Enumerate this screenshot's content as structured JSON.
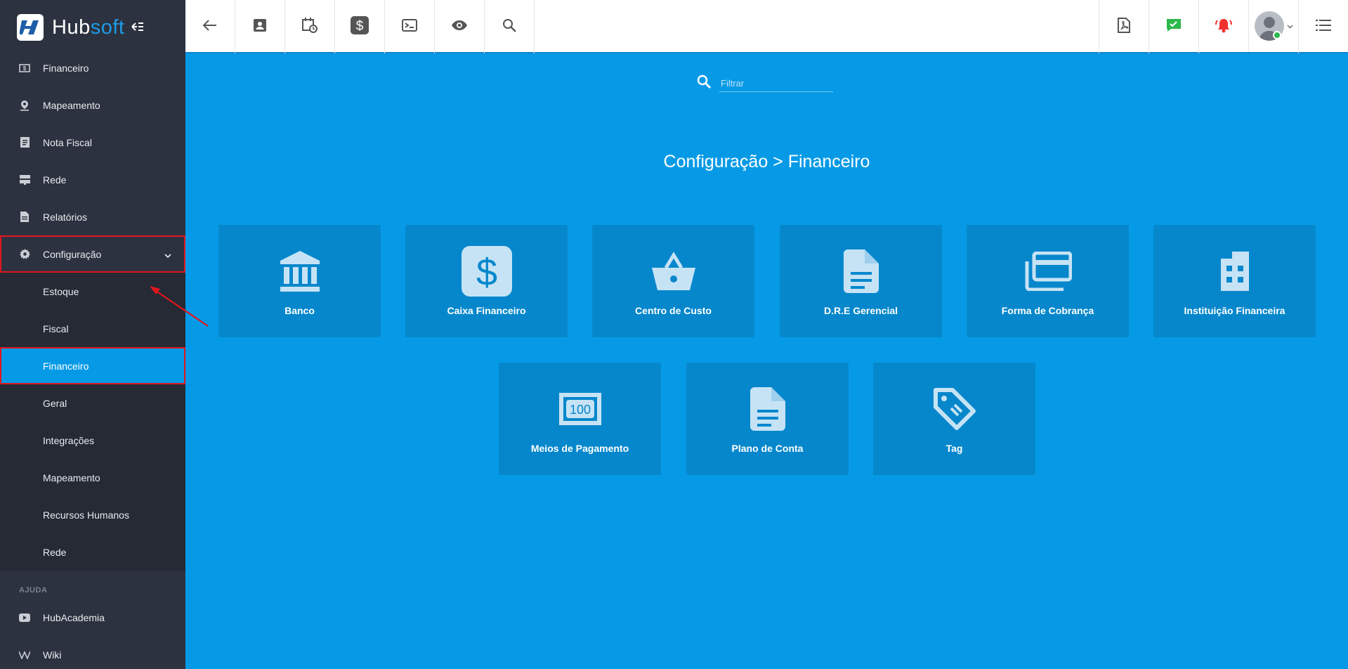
{
  "brand": {
    "name_main": "Hub",
    "name_accent": "soft"
  },
  "sidebar": {
    "items": [
      {
        "label": "Financeiro",
        "icon": "money-icon"
      },
      {
        "label": "Mapeamento",
        "icon": "map-pin-icon"
      },
      {
        "label": "Nota Fiscal",
        "icon": "receipt-icon"
      },
      {
        "label": "Rede",
        "icon": "server-icon"
      },
      {
        "label": "Relatórios",
        "icon": "report-icon"
      },
      {
        "label": "Configuração",
        "icon": "gear-icon",
        "expanded": true
      }
    ],
    "submenu": [
      {
        "label": "Estoque"
      },
      {
        "label": "Fiscal"
      },
      {
        "label": "Financeiro",
        "active": true
      },
      {
        "label": "Geral"
      },
      {
        "label": "Integrações"
      },
      {
        "label": "Mapeamento"
      },
      {
        "label": "Recursos Humanos"
      },
      {
        "label": "Rede"
      }
    ],
    "help_header": "AJUDA",
    "help_items": [
      {
        "label": "HubAcademia",
        "icon": "youtube-icon"
      },
      {
        "label": "Wiki",
        "icon": "wikipedia-icon"
      }
    ]
  },
  "topbar": {
    "left_icons": [
      "back-arrow-icon",
      "contact-card-icon",
      "calendar-clock-icon",
      "dollar-icon",
      "terminal-icon",
      "eye-icon",
      "search-icon"
    ],
    "right_icons": [
      "pdf-icon",
      "chat-check-icon",
      "bell-icon",
      "avatar",
      "menu-list-icon"
    ]
  },
  "main": {
    "filter": {
      "placeholder": "Filtrar",
      "value": ""
    },
    "title": "Configuração > Financeiro",
    "cards": [
      {
        "label": "Banco",
        "icon": "bank-icon"
      },
      {
        "label": "Caixa Financeiro",
        "icon": "cash-dollar-icon"
      },
      {
        "label": "Centro de Custo",
        "icon": "basket-icon"
      },
      {
        "label": "D.R.E Gerencial",
        "icon": "document-icon"
      },
      {
        "label": "Forma de Cobrança",
        "icon": "payment-cards-icon"
      },
      {
        "label": "Instituição Financeira",
        "icon": "building-icon"
      },
      {
        "label": "Meios de Pagamento",
        "icon": "money-bill-icon"
      },
      {
        "label": "Plano de Conta",
        "icon": "document-icon"
      },
      {
        "label": "Tag",
        "icon": "tag-icon"
      }
    ]
  },
  "colors": {
    "main_bg": "#069ae6",
    "card_bg": "#0687cc",
    "sidebar_bg": "#2d3240",
    "active_item": "#069ae6",
    "highlight_outline": "#e2161c",
    "notification_red": "#f0312e",
    "chat_green": "#2db84c"
  }
}
